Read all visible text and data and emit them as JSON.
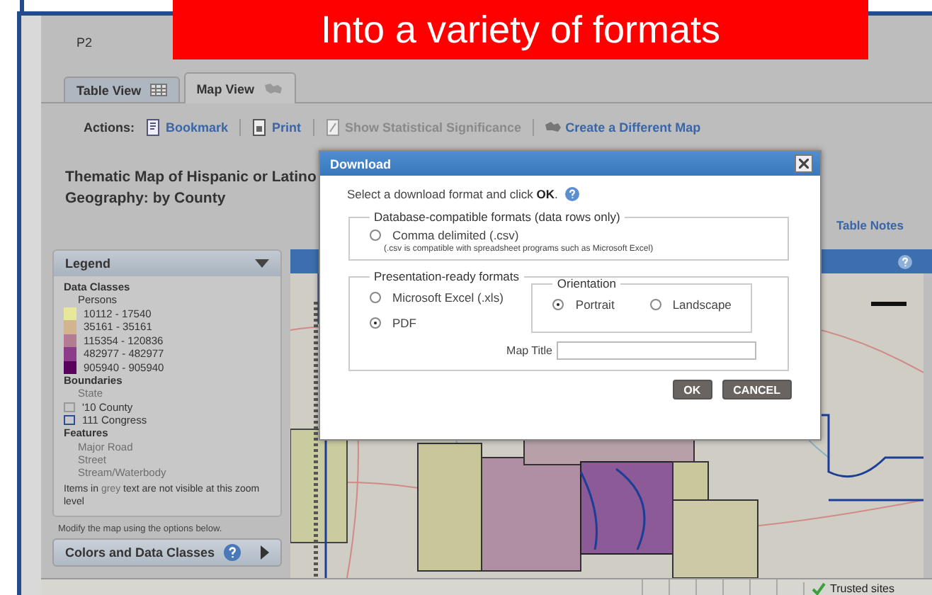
{
  "banner": {
    "title": "Into a variety of formats"
  },
  "page": {
    "page_label": "P2"
  },
  "tabs": [
    {
      "label": "Table View",
      "selected": false
    },
    {
      "label": "Map View",
      "selected": true
    }
  ],
  "actions": {
    "label": "Actions:",
    "items": [
      {
        "label": "Bookmark",
        "disabled": false,
        "kind": "bookmark"
      },
      {
        "label": "Print",
        "disabled": false,
        "kind": "print"
      },
      {
        "label": "Show Statistical Significance",
        "disabled": true,
        "kind": "significance"
      },
      {
        "label": "Create a Different Map",
        "disabled": false,
        "kind": "map"
      }
    ]
  },
  "map_title": {
    "line_1": "Thematic Map of Hispanic or Latino",
    "line_2": "Geography: by County"
  },
  "table_notes": "Table Notes",
  "legend": {
    "title": "Legend",
    "data_classes_heading": "Data Classes",
    "unit": "Persons",
    "classes": [
      {
        "label": "10112 - 17540",
        "color": "#e8e89a"
      },
      {
        "label": "35161 - 35161",
        "color": "#d2b48e"
      },
      {
        "label": "115354 - 120836",
        "color": "#b47c92"
      },
      {
        "label": "482977 - 482977",
        "color": "#8c3c8a"
      },
      {
        "label": "905940 - 905940",
        "color": "#5a005e"
      }
    ],
    "boundaries_heading": "Boundaries",
    "boundaries": [
      {
        "label": "State",
        "visible": false,
        "kind": "none"
      },
      {
        "label": "'10 County",
        "visible": true,
        "kind": "county"
      },
      {
        "label": "111 Congress",
        "visible": true,
        "kind": "congress"
      }
    ],
    "features_heading": "Features",
    "features": [
      {
        "label": "Major Road",
        "visible": false
      },
      {
        "label": "Street",
        "visible": false
      },
      {
        "label": "Stream/Waterbody",
        "visible": false
      }
    ],
    "note_before": "Items in ",
    "note_grey": "grey",
    "note_after": " text are not visible at this zoom level"
  },
  "modify_hint": "Modify the map using the options below.",
  "colors_panel": {
    "label": "Colors and Data Classes"
  },
  "dialog": {
    "title": "Download",
    "instruction": "Select a download format and click **OK**.",
    "database_group": {
      "legend": "Database-compatible formats (data rows only)",
      "options": [
        {
          "label": "Comma delimited (.csv)",
          "selected": false,
          "note": "(.csv is compatible with spreadsheet programs such as Microsoft Excel)"
        }
      ]
    },
    "presentation_group": {
      "legend": "Presentation-ready formats",
      "options": [
        {
          "label": "Microsoft Excel (.xls)",
          "selected": false
        },
        {
          "label": "PDF",
          "selected": true
        }
      ],
      "orientation": {
        "legend": "Orientation",
        "options": [
          {
            "label": "Portrait",
            "selected": true
          },
          {
            "label": "Landscape",
            "selected": false
          }
        ]
      },
      "map_title_label": "Map Title"
    },
    "buttons": [
      {
        "label": "OK"
      },
      {
        "label": "CANCEL"
      }
    ]
  },
  "status_bar": {
    "zone": "Trusted sites"
  }
}
